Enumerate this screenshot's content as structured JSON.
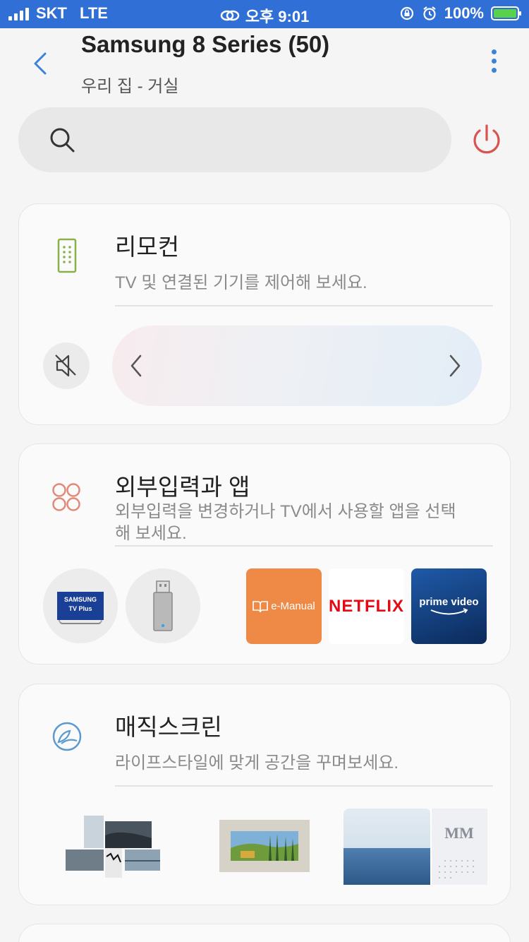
{
  "status_bar": {
    "carrier": "SKT",
    "network": "LTE",
    "time": "오후 9:01",
    "battery": "100%"
  },
  "header": {
    "title": "Samsung 8 Series (50)",
    "subtitle": "우리 집 - 거실"
  },
  "search": {
    "placeholder": ""
  },
  "remote_card": {
    "title": "리모컨",
    "description": "TV 및 연결된 기기를 제어해 보세요."
  },
  "input_card": {
    "title": "외부입력과 앱",
    "description": "외부입력을 변경하거나 TV에서 사용할 앱을 선택해 보세요.",
    "sources": [
      {
        "name": "SAMSUNG TV Plus",
        "logo_line1": "SAMSUNG",
        "logo_line2": "TV Plus"
      },
      {
        "name": "usb-drive"
      }
    ],
    "apps": [
      {
        "label": "e-Manual",
        "color": "#ef8a46"
      },
      {
        "label": "NETFLIX",
        "color": "#e50914"
      },
      {
        "label": "prime video",
        "color": "#0b2a5a"
      }
    ]
  },
  "magic_card": {
    "title": "매직스크린",
    "description": "라이프스타일에 맞게 공간을 꾸며보세요.",
    "thumb_text": "MM"
  },
  "colors": {
    "status_bar_bg": "#2f6fd6",
    "accent_blue": "#3b82d9",
    "power_red": "#d9534f",
    "remote_icon_green": "#8ab04a",
    "apps_icon_salmon": "#e08a7a",
    "magic_icon_blue": "#5b9ad0"
  }
}
